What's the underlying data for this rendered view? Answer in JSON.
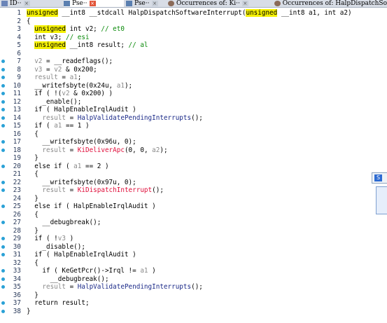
{
  "tabs": [
    {
      "label": "ID",
      "close": "×",
      "close_red": false
    },
    {
      "label": "Pse",
      "close": "×",
      "close_red": true
    },
    {
      "label": "Pse",
      "close": "×",
      "close_red": false
    },
    {
      "label": "Occurrences of: Ki",
      "close": "×",
      "close_red": false
    },
    {
      "label": "Occurrences of: HalpDispatchSo",
      "close": "",
      "close_red": false
    }
  ],
  "code_lines": [
    {
      "n": "1",
      "bp": false,
      "segs": [
        {
          "c": "hl",
          "t": "unsigned"
        },
        {
          "c": "",
          "t": " __int8 __stdcall HalpDispatchSoftwareInterrupt("
        },
        {
          "c": "hl",
          "t": "unsigned"
        },
        {
          "c": "",
          "t": " __int8 a1, int a2)"
        }
      ]
    },
    {
      "n": "2",
      "bp": false,
      "segs": [
        {
          "c": "",
          "t": "{"
        }
      ]
    },
    {
      "n": "3",
      "bp": false,
      "segs": [
        {
          "c": "",
          "t": "  "
        },
        {
          "c": "hl",
          "t": "unsigned"
        },
        {
          "c": "",
          "t": " int v2; "
        },
        {
          "c": "cm",
          "t": "// et0"
        }
      ]
    },
    {
      "n": "4",
      "bp": false,
      "segs": [
        {
          "c": "",
          "t": "  int v3; "
        },
        {
          "c": "cm",
          "t": "// esi"
        }
      ]
    },
    {
      "n": "5",
      "bp": false,
      "segs": [
        {
          "c": "",
          "t": "  "
        },
        {
          "c": "hl",
          "t": "unsigned"
        },
        {
          "c": "",
          "t": " __int8 result; "
        },
        {
          "c": "cm",
          "t": "// al"
        }
      ]
    },
    {
      "n": "6",
      "bp": false,
      "segs": [
        {
          "c": "",
          "t": ""
        }
      ]
    },
    {
      "n": "7",
      "bp": true,
      "segs": [
        {
          "c": "",
          "t": "  "
        },
        {
          "c": "gr",
          "t": "v2"
        },
        {
          "c": "",
          "t": " = __readeflags();"
        }
      ]
    },
    {
      "n": "8",
      "bp": true,
      "segs": [
        {
          "c": "",
          "t": "  "
        },
        {
          "c": "gr",
          "t": "v3"
        },
        {
          "c": "",
          "t": " = "
        },
        {
          "c": "gr",
          "t": "v2"
        },
        {
          "c": "",
          "t": " & 0x200;"
        }
      ]
    },
    {
      "n": "9",
      "bp": true,
      "segs": [
        {
          "c": "",
          "t": "  "
        },
        {
          "c": "gr",
          "t": "result"
        },
        {
          "c": "",
          "t": " = "
        },
        {
          "c": "gr",
          "t": "a1"
        },
        {
          "c": "",
          "t": ";"
        }
      ]
    },
    {
      "n": "10",
      "bp": true,
      "segs": [
        {
          "c": "",
          "t": "  __writefsbyte(0x24u, "
        },
        {
          "c": "gr",
          "t": "a1"
        },
        {
          "c": "",
          "t": ");"
        }
      ]
    },
    {
      "n": "11",
      "bp": true,
      "segs": [
        {
          "c": "",
          "t": "  if ( !("
        },
        {
          "c": "gr",
          "t": "v2"
        },
        {
          "c": "",
          "t": " & 0x200) )"
        }
      ]
    },
    {
      "n": "12",
      "bp": true,
      "segs": [
        {
          "c": "",
          "t": "    _enable();"
        }
      ]
    },
    {
      "n": "13",
      "bp": true,
      "segs": [
        {
          "c": "",
          "t": "  if ( HalpEnableIrqlAudit )"
        }
      ]
    },
    {
      "n": "14",
      "bp": true,
      "segs": [
        {
          "c": "",
          "t": "    "
        },
        {
          "c": "gr",
          "t": "result"
        },
        {
          "c": "",
          "t": " = "
        },
        {
          "c": "navy",
          "t": "HalpValidatePendingInterrupts"
        },
        {
          "c": "",
          "t": "();"
        }
      ]
    },
    {
      "n": "15",
      "bp": true,
      "segs": [
        {
          "c": "",
          "t": "  if ( "
        },
        {
          "c": "gr",
          "t": "a1"
        },
        {
          "c": "",
          "t": " == 1 )"
        }
      ]
    },
    {
      "n": "16",
      "bp": false,
      "segs": [
        {
          "c": "",
          "t": "  {"
        }
      ]
    },
    {
      "n": "17",
      "bp": true,
      "segs": [
        {
          "c": "",
          "t": "    __writefsbyte(0x96u, 0);"
        }
      ]
    },
    {
      "n": "18",
      "bp": true,
      "segs": [
        {
          "c": "",
          "t": "    "
        },
        {
          "c": "gr",
          "t": "result"
        },
        {
          "c": "",
          "t": " = "
        },
        {
          "c": "rd",
          "t": "KiDeliverApc"
        },
        {
          "c": "",
          "t": "(0, 0, "
        },
        {
          "c": "gr",
          "t": "a2"
        },
        {
          "c": "",
          "t": ");"
        }
      ]
    },
    {
      "n": "19",
      "bp": false,
      "segs": [
        {
          "c": "",
          "t": "  }"
        }
      ]
    },
    {
      "n": "20",
      "bp": true,
      "segs": [
        {
          "c": "",
          "t": "  else if ( "
        },
        {
          "c": "gr",
          "t": "a1"
        },
        {
          "c": "",
          "t": " == 2 )"
        }
      ]
    },
    {
      "n": "21",
      "bp": false,
      "segs": [
        {
          "c": "",
          "t": "  {"
        }
      ]
    },
    {
      "n": "22",
      "bp": true,
      "segs": [
        {
          "c": "",
          "t": "    __writefsbyte(0x97u, 0);"
        }
      ]
    },
    {
      "n": "23",
      "bp": true,
      "segs": [
        {
          "c": "",
          "t": "    "
        },
        {
          "c": "gr",
          "t": "result"
        },
        {
          "c": "",
          "t": " = "
        },
        {
          "c": "rd",
          "t": "KiDispatchInterrupt"
        },
        {
          "c": "",
          "t": "();"
        }
      ]
    },
    {
      "n": "24",
      "bp": false,
      "segs": [
        {
          "c": "",
          "t": "  }"
        }
      ]
    },
    {
      "n": "25",
      "bp": true,
      "segs": [
        {
          "c": "",
          "t": "  else if ( HalpEnableIrqlAudit )"
        }
      ]
    },
    {
      "n": "26",
      "bp": false,
      "segs": [
        {
          "c": "",
          "t": "  {"
        }
      ]
    },
    {
      "n": "27",
      "bp": true,
      "segs": [
        {
          "c": "",
          "t": "    __debugbreak();"
        }
      ]
    },
    {
      "n": "28",
      "bp": false,
      "segs": [
        {
          "c": "",
          "t": "  }"
        }
      ]
    },
    {
      "n": "29",
      "bp": true,
      "segs": [
        {
          "c": "",
          "t": "  if ( !"
        },
        {
          "c": "gr",
          "t": "v3"
        },
        {
          "c": "",
          "t": " )"
        }
      ]
    },
    {
      "n": "30",
      "bp": true,
      "segs": [
        {
          "c": "",
          "t": "    _disable();"
        }
      ]
    },
    {
      "n": "31",
      "bp": true,
      "segs": [
        {
          "c": "",
          "t": "  if ( HalpEnableIrqlAudit )"
        }
      ]
    },
    {
      "n": "32",
      "bp": false,
      "segs": [
        {
          "c": "",
          "t": "  {"
        }
      ]
    },
    {
      "n": "33",
      "bp": true,
      "segs": [
        {
          "c": "",
          "t": "    if ( KeGetPcr()->Irql != "
        },
        {
          "c": "gr",
          "t": "a1"
        },
        {
          "c": "",
          "t": " )"
        }
      ]
    },
    {
      "n": "34",
      "bp": true,
      "segs": [
        {
          "c": "",
          "t": "      __debugbreak();"
        }
      ]
    },
    {
      "n": "35",
      "bp": true,
      "segs": [
        {
          "c": "",
          "t": "    "
        },
        {
          "c": "gr",
          "t": "result"
        },
        {
          "c": "",
          "t": " = "
        },
        {
          "c": "navy",
          "t": "HalpValidatePendingInterrupts"
        },
        {
          "c": "",
          "t": "();"
        }
      ]
    },
    {
      "n": "36",
      "bp": false,
      "segs": [
        {
          "c": "",
          "t": "  }"
        }
      ]
    },
    {
      "n": "37",
      "bp": true,
      "segs": [
        {
          "c": "",
          "t": "  return result;"
        }
      ]
    },
    {
      "n": "38",
      "bp": true,
      "segs": [
        {
          "c": "",
          "t": "}"
        }
      ]
    }
  ],
  "side_window": {
    "icon_letter": "S"
  },
  "colors": {
    "highlight": "#f4f000",
    "comment": "#0a8a0a",
    "variable": "#8a8a8a",
    "red_call": "#e0103c",
    "breakpoint_dot": "#2aa1d6"
  }
}
